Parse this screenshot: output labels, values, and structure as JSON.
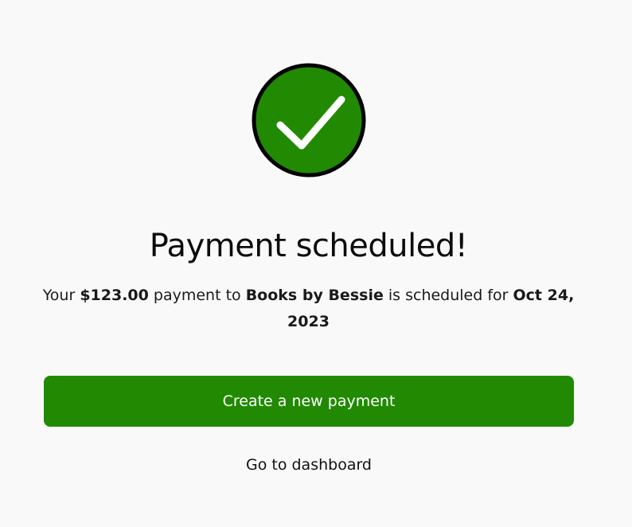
{
  "success_icon": {
    "name": "checkmark-icon",
    "fill_color": "#218a02",
    "stroke_color": "#000000"
  },
  "header": {
    "title": "Payment scheduled!"
  },
  "message": {
    "prefix": "Your ",
    "amount": "$123.00",
    "middle": " payment to ",
    "payee": "Books by Bessie",
    "suffix": " is scheduled for ",
    "date": "Oct 24, 2023"
  },
  "actions": {
    "primary_label": "Create a new payment",
    "secondary_label": "Go to dashboard"
  },
  "colors": {
    "accent": "#218a02",
    "background": "#f9f9f9",
    "text": "#111111"
  }
}
